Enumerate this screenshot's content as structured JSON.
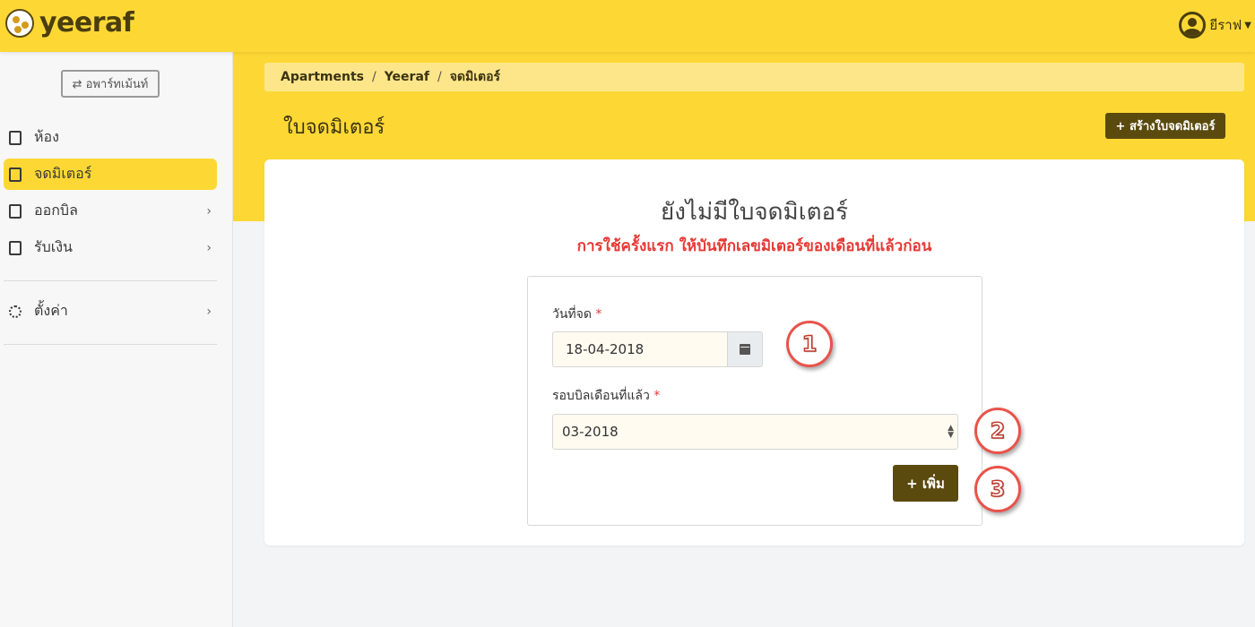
{
  "topbar": {
    "logo_text": "yeeraf",
    "user_name": "ยีราฟ",
    "brand_color": "#fdd835"
  },
  "sidebar": {
    "apartment_button": "⇄ อพาร์ทเม้นท์",
    "items": [
      {
        "label": "ห้อง",
        "icon": "contact-card-icon",
        "active": false,
        "has_chevron": false
      },
      {
        "label": "จดมิเตอร์",
        "icon": "edit-document-icon",
        "active": true,
        "has_chevron": false
      },
      {
        "label": "ออกบิล",
        "icon": "document-icon",
        "active": false,
        "has_chevron": true
      },
      {
        "label": "รับเงิน",
        "icon": "document-icon",
        "active": false,
        "has_chevron": true
      },
      {
        "label": "ตั้งค่า",
        "icon": "gear-icon",
        "active": false,
        "has_chevron": true
      }
    ],
    "chevron": "›"
  },
  "breadcrumb": {
    "items": [
      "Apartments",
      "Yeeraf",
      "จดมิเตอร์"
    ],
    "separator": "/"
  },
  "header": {
    "title": "ใบจดมิเตอร์",
    "create_button": "+ สร้างใบจดมิเตอร์"
  },
  "empty_state": {
    "title": "ยังไม่มีใบจดมิเตอร์",
    "subtitle": "การใช้ครั้งแรก ให้บันทึกเลขมิเตอร์ของเดือนที่แล้วก่อน"
  },
  "form": {
    "date_label": "วันที่จด",
    "date_value": "18-04-2018",
    "period_label": "รอบบิลเดือนที่แล้ว",
    "period_value": "03-2018",
    "required_mark": "*",
    "add_button": "+ เพิ่ม"
  },
  "annotations": [
    "1",
    "2",
    "3"
  ],
  "colors": {
    "accent_dark": "#5b4a0e",
    "error": "#e53935",
    "annotation": "#e9534a"
  }
}
